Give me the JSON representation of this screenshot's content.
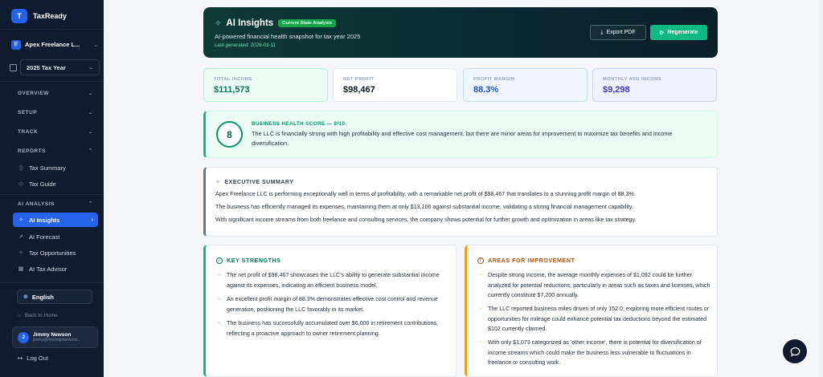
{
  "app": {
    "logo_letter": "T",
    "name": "TaxReady"
  },
  "sidebar": {
    "entity_letter": "E",
    "entity_name": "Apex Freelance L...",
    "tax_year": "2025 Tax Year",
    "sections": {
      "overview": "OVERVIEW",
      "setup": "SETUP",
      "track": "TRACK",
      "reports": "REPORTS",
      "ai_analysis": "AI ANALYSIS"
    },
    "reports_items": [
      {
        "label": "Tax Summary",
        "icon": "book-icon"
      },
      {
        "label": "Tax Guide",
        "icon": "guide-icon"
      }
    ],
    "ai_items": [
      {
        "label": "AI Insights",
        "icon": "sparkle-icon",
        "active": true
      },
      {
        "label": "AI Forecast",
        "icon": "trend-icon"
      },
      {
        "label": "Tax Opportunities",
        "icon": "sparkle-icon"
      },
      {
        "label": "AI Tax Advisor",
        "icon": "calculator-icon"
      }
    ],
    "language": "English",
    "back_home": "Back to Home",
    "user": {
      "initial": "J",
      "name": "Jimmy Newson",
      "email": "jimmy@movingtowelcom..."
    },
    "logout": "Log Out"
  },
  "hero": {
    "title": "AI Insights",
    "badge": "Current State Analysis",
    "subtitle": "AI-powered financial health snapshot for tax year 2025",
    "generated": "Last generated: 2026-03-11",
    "export_label": "Export PDF",
    "regenerate_label": "Regenerate"
  },
  "stats": [
    {
      "label": "TOTAL INCOME",
      "value": "$111,573"
    },
    {
      "label": "NET PROFIT",
      "value": "$98,467"
    },
    {
      "label": "PROFIT MARGIN",
      "value": "88.3%"
    },
    {
      "label": "MONTHLY AVG INCOME",
      "value": "$9,298"
    }
  ],
  "health": {
    "score": "8",
    "label": "BUSINESS HEALTH SCORE — 8/10",
    "text": "The LLC is financially strong with high profitability and effective cost management, but there are minor areas for improvement to maximize tax benefits and income diversification."
  },
  "executive": {
    "title": "EXECUTIVE SUMMARY",
    "paragraphs": [
      "Apex Freelance LLC is performing exceptionally well in terms of profitability, with a remarkable net profit of $98,467 that translates to a stunning profit margin of 88.3%.",
      "The business has efficiently managed its expenses, maintaining them at only $13,106 against substantial income, validating a strong financial management capability.",
      "With significant income streams from both freelance and consulting services, the company shows potential for further growth and optimization in areas like tax strategy."
    ]
  },
  "strengths": {
    "title": "KEY STRENGTHS",
    "items": [
      "The net profit of $98,467 showcases the LLC's ability to generate substantial income against its expenses, indicating an efficient business model.",
      "An excellent profit margin of 88.3% demonstrates effective cost control and revenue generation, positioning the LLC favorably in its market.",
      "The business has successfully accumulated over $6,000 in retirement contributions, reflecting a proactive approach to owner retirement planning."
    ]
  },
  "improvements": {
    "title": "AREAS FOR IMPROVEMENT",
    "items": [
      "Despite strong income, the average monthly expenses of $1,092 could be further analyzed for potential reductions, particularly in areas such as taxes and licenses, which currently constitute $7,200 annually.",
      "The LLC reported business miles driven of only 152.0; exploring more efficient routes or opportunities for mileage could enhance potential tax deductions beyond the estimated $102 currently claimed.",
      "With only $1,073 categorized as 'other income', there is potential for diversification of income streams which could make the business less vulnerable to fluctuations in freelance or consulting work."
    ]
  },
  "colors": {
    "accent": "#10b981",
    "primary": "#2563eb",
    "sidebar_bg": "#0f1b2e",
    "warning": "#f59e0b"
  }
}
